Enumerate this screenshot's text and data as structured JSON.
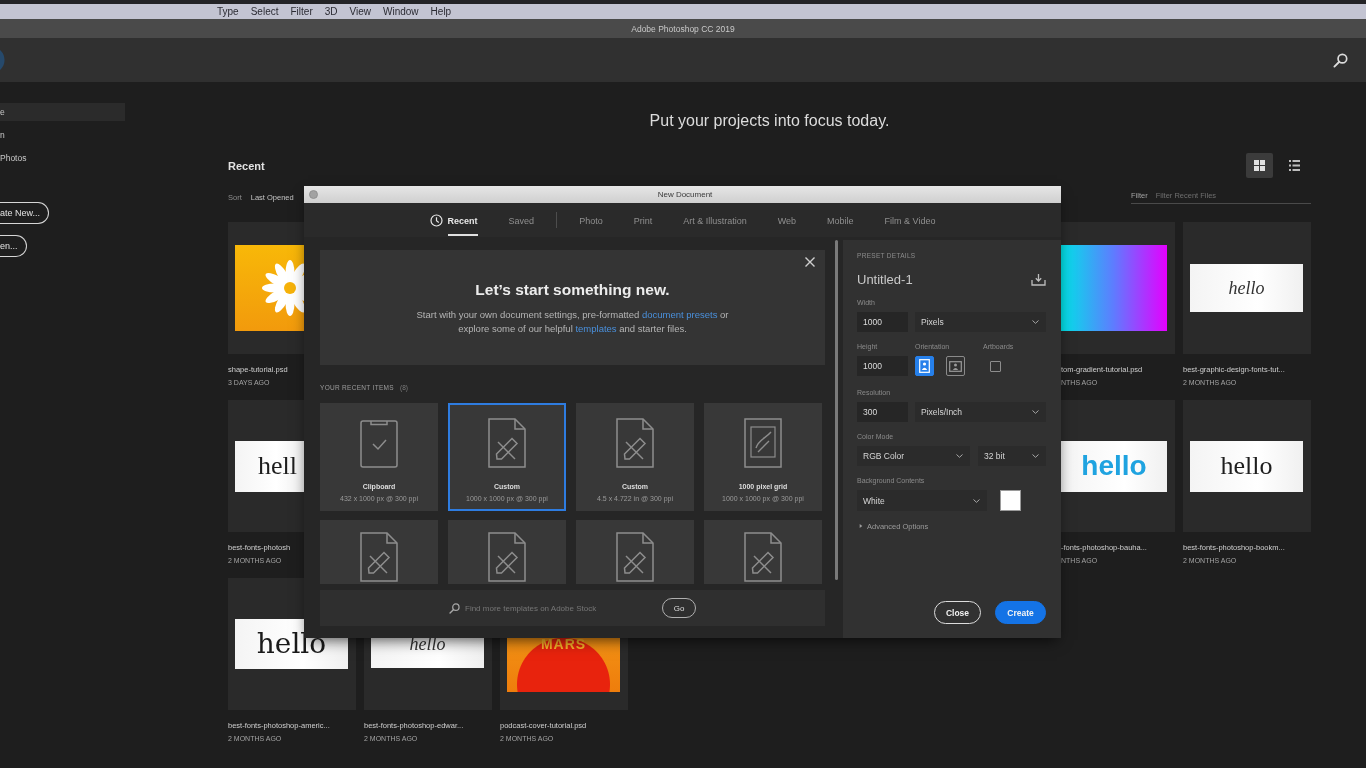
{
  "menu_bar": {
    "items": [
      "Type",
      "Select",
      "Filter",
      "3D",
      "View",
      "Window",
      "Help"
    ]
  },
  "window": {
    "title": "Adobe Photoshop CC 2019"
  },
  "sidebar": {
    "items": [
      {
        "label": "e",
        "selected": true
      },
      {
        "label": "n",
        "selected": false
      },
      {
        "label": "Photos",
        "selected": false
      }
    ],
    "buttons": [
      "ate New...",
      "en..."
    ]
  },
  "home": {
    "headline": "Put your projects into focus today.",
    "section_title": "Recent",
    "view_toggles": [
      {
        "kind": "grid",
        "selected": true
      },
      {
        "kind": "list",
        "selected": false
      }
    ],
    "sort": {
      "label": "Sort",
      "value": "Last Opened"
    },
    "filter": {
      "label": "Filter",
      "placeholder": "Filter Recent Files"
    },
    "file_rows": [
      {
        "left": [
          {
            "name": "shape-tutorial.psd",
            "age": "3 DAYS AGO",
            "thumb": {
              "kind": "sunburst"
            }
          }
        ],
        "right": [
          {
            "name": "tom-gradient-tutorial.psd",
            "age": "NTHS AGO",
            "thumb": {
              "kind": "gradient"
            }
          },
          {
            "name": "best-graphic-design-fonts-tut...",
            "age": "2 MONTHS AGO",
            "thumb": {
              "kind": "script",
              "text": "hello"
            }
          }
        ]
      },
      {
        "left": [
          {
            "name": "best-fonts-photosh",
            "age": "2 MONTHS AGO",
            "thumb": {
              "kind": "serif",
              "text": "hell"
            }
          }
        ],
        "right": [
          {
            "name": "-fonts-photoshop-bauha...",
            "age": "NTHS AGO",
            "thumb": {
              "kind": "bold",
              "text": "hello"
            }
          },
          {
            "name": "best-fonts-photoshop-bookm...",
            "age": "2 MONTHS AGO",
            "thumb": {
              "kind": "serif",
              "text": "hello"
            }
          }
        ]
      },
      {
        "left": [
          {
            "name": "best-fonts-photoshop-americ...",
            "age": "2 MONTHS AGO",
            "thumb": {
              "kind": "slab",
              "text": "hello"
            }
          },
          {
            "name": "best-fonts-photoshop-edwar...",
            "age": "2 MONTHS AGO",
            "thumb": {
              "kind": "script",
              "text": "hello"
            }
          },
          {
            "name": "podcast-cover-tutorial.psd",
            "age": "2 MONTHS AGO",
            "thumb": {
              "kind": "poster",
              "text": "MARS"
            }
          }
        ],
        "right": []
      }
    ]
  },
  "dialog": {
    "title": "New Document",
    "tabs": [
      {
        "kind": "recent",
        "label": "Recent",
        "selected": true
      },
      {
        "kind": "saved",
        "label": "Saved",
        "selected": false
      },
      {
        "kind": "preset",
        "label": "Photo",
        "selected": false
      },
      {
        "kind": "preset",
        "label": "Print",
        "selected": false
      },
      {
        "kind": "preset",
        "label": "Art & Illustration",
        "selected": false
      },
      {
        "kind": "preset",
        "label": "Web",
        "selected": false
      },
      {
        "kind": "preset",
        "label": "Mobile",
        "selected": false
      },
      {
        "kind": "preset",
        "label": "Film & Video",
        "selected": false
      }
    ],
    "welcome": {
      "title": "Let’s start something new.",
      "text_parts": [
        {
          "kind": "text",
          "text": "Start with your own document settings, pre-formatted "
        },
        {
          "kind": "link",
          "text": "document presets"
        },
        {
          "kind": "text",
          "text": " or explore some of our helpful "
        },
        {
          "kind": "link",
          "text": "templates"
        },
        {
          "kind": "text",
          "text": " and starter files."
        }
      ]
    },
    "recent_items": {
      "heading": "YOUR RECENT ITEMS",
      "count": "(8)",
      "items": [
        {
          "kind": "clipboard",
          "name": "Clipboard",
          "detail": "432 x 1000 px @ 300 ppi",
          "selected": false
        },
        {
          "kind": "document",
          "name": "Custom",
          "detail": "1000 x 1000 px @ 300 ppi",
          "selected": true
        },
        {
          "kind": "document",
          "name": "Custom",
          "detail": "4.5 x 4.722 in @ 300 ppi",
          "selected": false
        },
        {
          "kind": "grid",
          "name": "1000 pixel grid",
          "detail": "1000 x 1000 px @ 300 ppi",
          "selected": false
        },
        {
          "kind": "document",
          "selected": false
        },
        {
          "kind": "document",
          "selected": false
        },
        {
          "kind": "document",
          "selected": false
        },
        {
          "kind": "document",
          "selected": false
        }
      ]
    },
    "search": {
      "placeholder": "Find more templates on Adobe Stock",
      "button": "Go"
    },
    "preset_details": {
      "heading": "PRESET DETAILS",
      "name": "Untitled-1",
      "width": {
        "label": "Width",
        "value": "1000",
        "unit": "Pixels"
      },
      "height": {
        "label": "Height",
        "value": "1000"
      },
      "orientation": {
        "label": "Orientation",
        "options": [
          {
            "kind": "portrait",
            "selected": true
          },
          {
            "kind": "landscape",
            "selected": false
          }
        ]
      },
      "artboards": {
        "label": "Artboards",
        "checked": false
      },
      "resolution": {
        "label": "Resolution",
        "value": "300",
        "unit": "Pixels/Inch"
      },
      "color_mode": {
        "label": "Color Mode",
        "mode": "RGB Color",
        "depth": "32 bit"
      },
      "background": {
        "label": "Background Contents",
        "value": "White",
        "color": "#ffffff"
      },
      "advanced": {
        "label": "Advanced Options",
        "expanded": false
      }
    },
    "buttons": [
      {
        "kind": "secondary",
        "label": "Close"
      },
      {
        "kind": "primary",
        "label": "Create"
      }
    ]
  }
}
